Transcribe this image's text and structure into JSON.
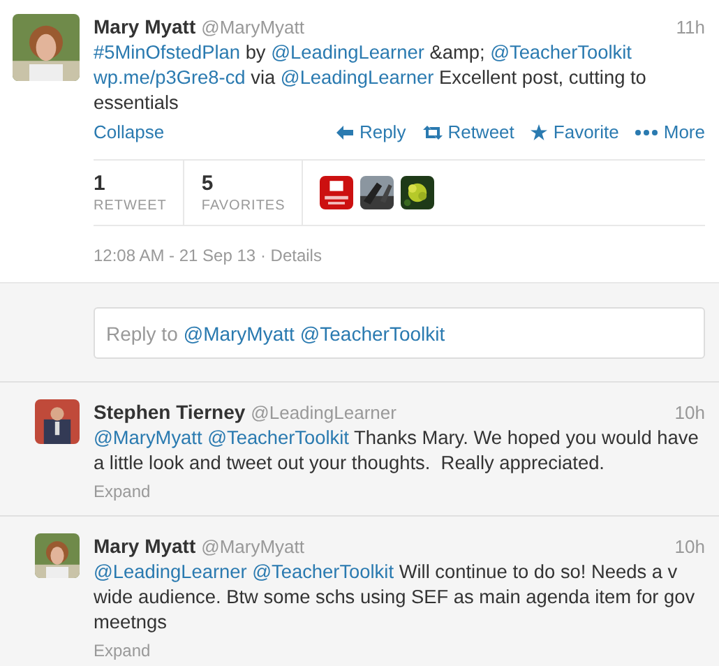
{
  "main_tweet": {
    "name": "Mary Myatt",
    "handle": "@MaryMyatt",
    "time": "11h",
    "segments": [
      {
        "kind": "link",
        "text": "#5MinOfstedPlan"
      },
      {
        "kind": "plain",
        "text": "by"
      },
      {
        "kind": "link",
        "text": "@LeadingLearner"
      },
      {
        "kind": "plain",
        "text": "&amp;"
      },
      {
        "kind": "link",
        "text": "@TeacherToolkit"
      },
      {
        "kind": "link",
        "text": "wp.me/p3Gre8-cd"
      },
      {
        "kind": "plain",
        "text": "via"
      },
      {
        "kind": "link",
        "text": "@LeadingLearner"
      },
      {
        "kind": "plain",
        "text": "Excellent post, cutting to essentials"
      }
    ],
    "toggle": "Collapse",
    "actions": [
      {
        "kind": "reply",
        "label": "Reply"
      },
      {
        "kind": "retweet",
        "label": "Retweet"
      },
      {
        "kind": "favorite",
        "label": "Favorite"
      },
      {
        "kind": "more",
        "label": "More"
      }
    ],
    "stats": [
      {
        "count": "1",
        "label": "RETWEET"
      },
      {
        "count": "5",
        "label": "FAVORITES"
      }
    ],
    "timestamp": "12:08 AM - 21 Sep 13",
    "separator": "·",
    "details": "Details"
  },
  "reply_box": {
    "prefix": "Reply to",
    "mentions": [
      "@MaryMyatt",
      "@TeacherToolkit"
    ]
  },
  "replies": [
    {
      "name": "Stephen Tierney",
      "handle": "@LeadingLearner",
      "time": "10h",
      "segments": [
        {
          "kind": "link",
          "text": "@MaryMyatt"
        },
        {
          "kind": "link",
          "text": "@TeacherToolkit"
        },
        {
          "kind": "plain",
          "text": "Thanks Mary. We hoped you would have a little look and tweet out your thoughts.  Really appreciated."
        }
      ],
      "toggle": "Expand"
    },
    {
      "name": "Mary Myatt",
      "handle": "@MaryMyatt",
      "time": "10h",
      "segments": [
        {
          "kind": "link",
          "text": "@LeadingLearner"
        },
        {
          "kind": "link",
          "text": "@TeacherToolkit"
        },
        {
          "kind": "plain",
          "text": "Will continue to do so! Needs a v wide audience. Btw some schs using SEF as main agenda item for gov meetngs"
        }
      ],
      "toggle": "Expand"
    }
  ]
}
